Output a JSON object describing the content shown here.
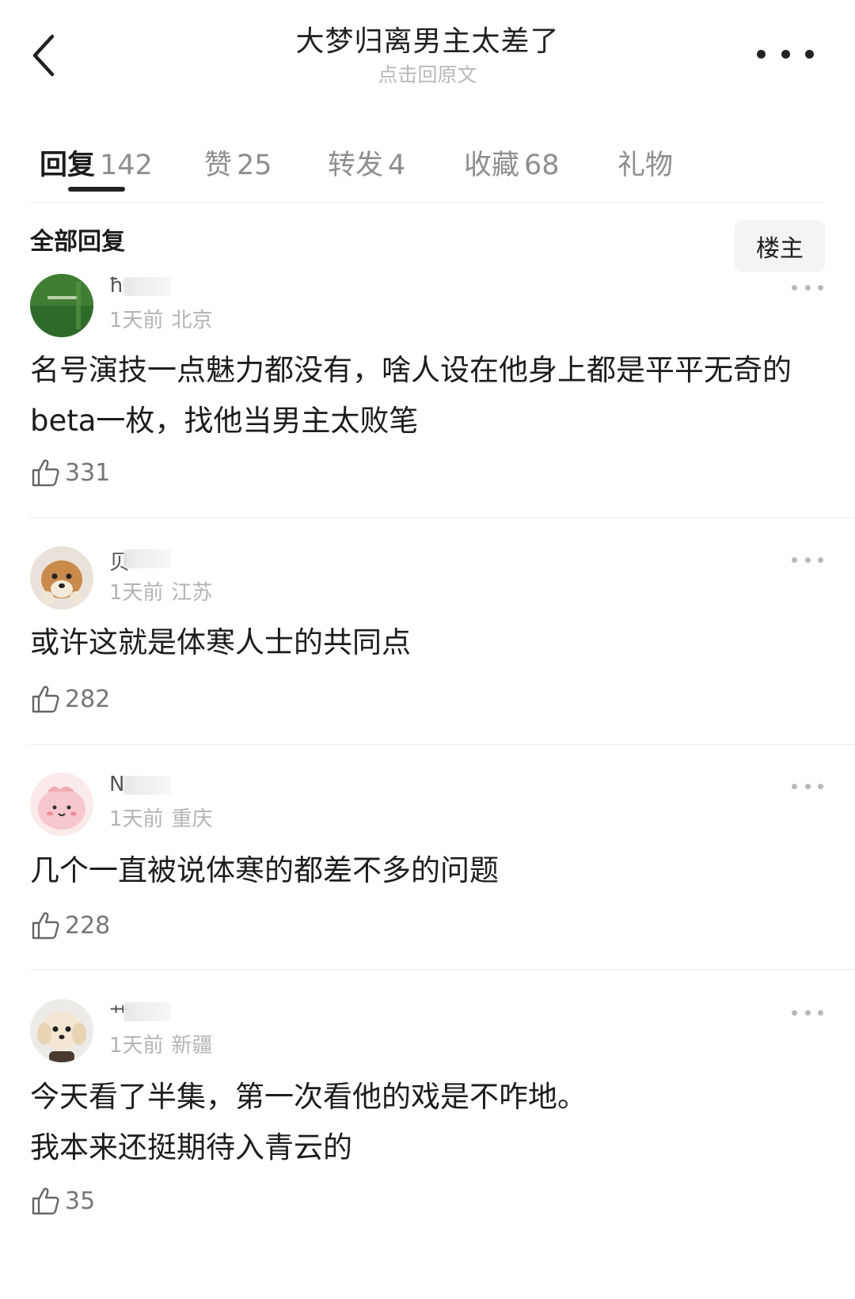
{
  "header": {
    "title": "大梦归离男主太差了",
    "subtitle": "点击回原文"
  },
  "tabs": [
    {
      "label": "回复",
      "count": "142"
    },
    {
      "label": "赞",
      "count": "25"
    },
    {
      "label": "转发",
      "count": "4"
    },
    {
      "label": "收藏",
      "count": "68"
    },
    {
      "label": "礼物",
      "count": ""
    }
  ],
  "section": {
    "title": "全部回复",
    "owner_label": "楼主"
  },
  "comments": [
    {
      "name_fragment": "ħ",
      "time": "1天前",
      "location": "北京",
      "text": "名号演技一点魅力都没有，啥人设在他身上都是平平无奇的beta一枚，找他当男主太败笔",
      "likes": "331",
      "avatar": "green-poster-avatar"
    },
    {
      "name_fragment": "贝",
      "time": "1天前",
      "location": "江苏",
      "text": "或许这就是体寒人士的共同点",
      "likes": "282",
      "avatar": "shiba-dog-avatar"
    },
    {
      "name_fragment": "N",
      "time": "1天前",
      "location": "重庆",
      "text": "几个一直被说体寒的都差不多的问题",
      "likes": "228",
      "avatar": "pink-blob-avatar"
    },
    {
      "name_fragment": "艹",
      "time": "1天前",
      "location": "新疆",
      "text": "今天看了半集，第一次看他的戏是不咋地。\n我本来还挺期待入青云的",
      "line1": "今天看了半集，第一次看他的戏是不咋地。",
      "line2": "我本来还挺期待入青云的",
      "likes": "35",
      "avatar": "poodle-dog-avatar"
    }
  ]
}
